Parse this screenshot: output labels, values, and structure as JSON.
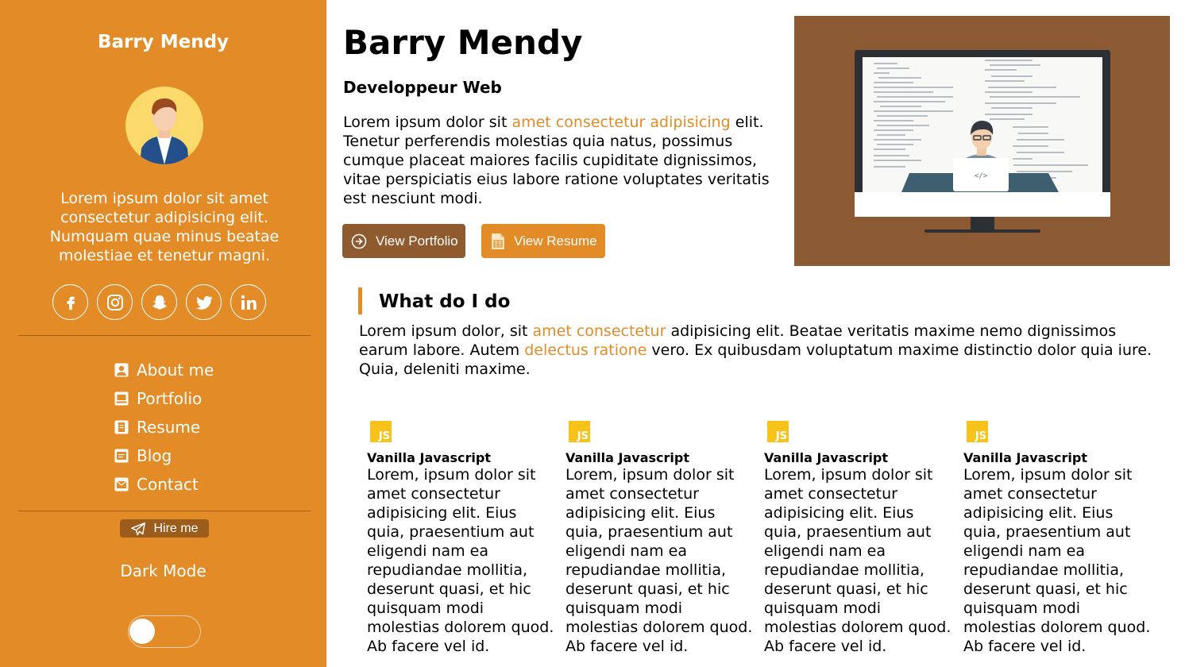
{
  "sidebar": {
    "name": "Barry Mendy",
    "bio": "Lorem ipsum dolor sit amet consectetur adipisicing elit. Numquam quae minus beatae molestiae et tenetur magni.",
    "socials": [
      "facebook-icon",
      "instagram-icon",
      "snapchat-icon",
      "twitter-icon",
      "linkedin-icon"
    ],
    "nav": [
      {
        "label": "About me",
        "icon": "user-icon"
      },
      {
        "label": "Portfolio",
        "icon": "laptop-icon"
      },
      {
        "label": "Resume",
        "icon": "file-icon"
      },
      {
        "label": "Blog",
        "icon": "blog-icon"
      },
      {
        "label": "Contact",
        "icon": "envelope-icon"
      }
    ],
    "hire_label": "Hire me",
    "dark_mode_label": "Dark Mode",
    "dark_mode_on": false
  },
  "main": {
    "title": "Barry Mendy",
    "subtitle": "Developpeur Web",
    "intro": {
      "before": "Lorem ipsum dolor sit ",
      "highlight": "amet consectetur adipisicing",
      "after": " elit. Tenetur perferendis molestias quia natus, possimus cumque placeat maiores facilis cupiditate dignissimos, vitae perspiciatis eius labore ratione voluptates veritatis est nesciunt modi."
    },
    "buttons": {
      "portfolio": "View Portfolio",
      "resume": "View Resume"
    }
  },
  "section": {
    "title": "What do I do",
    "text": {
      "p1": "Lorem ipsum dolor, sit ",
      "h1": "amet consectetur",
      "p2": " adipisicing elit. Beatae veritatis maxime nemo dignissimos earum labore. Autem ",
      "h2": "delectus ratione",
      "p3": " vero. Ex quibusdam voluptatum maxime distinctio dolor quia iure. Quia, deleniti maxime."
    }
  },
  "cards": [
    {
      "badge": "JS",
      "title": "Vanilla Javascript",
      "text": "Lorem, ipsum dolor sit amet consectetur adipisicing elit. Eius quia, praesentium aut eligendi nam ea repudiandae mollitia, deserunt quasi, et hic quisquam modi molestias dolorem quod. Ab facere vel id."
    },
    {
      "badge": "JS",
      "title": "Vanilla Javascript",
      "text": "Lorem, ipsum dolor sit amet consectetur adipisicing elit. Eius quia, praesentium aut eligendi nam ea repudiandae mollitia, deserunt quasi, et hic quisquam modi molestias dolorem quod. Ab facere vel id."
    },
    {
      "badge": "JS",
      "title": "Vanilla Javascript",
      "text": "Lorem, ipsum dolor sit amet consectetur adipisicing elit. Eius quia, praesentium aut eligendi nam ea repudiandae mollitia, deserunt quasi, et hic quisquam modi molestias dolorem quod. Ab facere vel id."
    },
    {
      "badge": "JS",
      "title": "Vanilla Javascript",
      "text": "Lorem, ipsum dolor sit amet consectetur adipisicing elit. Eius quia, praesentium aut eligendi nam ea repudiandae mollitia, deserunt quasi, et hic quisquam modi molestias dolorem quod. Ab facere vel id."
    }
  ],
  "colors": {
    "accent": "#e38b26",
    "brown": "#8e5a2e",
    "hero_bg": "#8b5a33",
    "js_yellow": "#f7c31b"
  }
}
